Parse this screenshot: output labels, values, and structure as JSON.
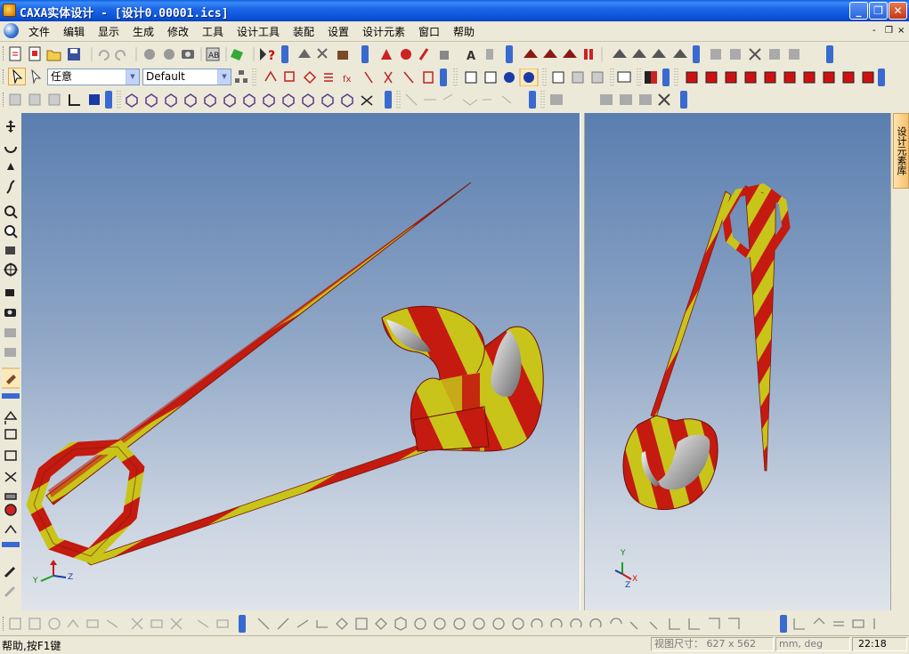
{
  "window": {
    "title": "CAXA实体设计 - [设计0.00001.ics]",
    "buttons": {
      "minimize": "_",
      "restore": "❐",
      "close": "✕"
    }
  },
  "menubar": {
    "items": [
      "文件",
      "编辑",
      "显示",
      "生成",
      "修改",
      "工具",
      "设计工具",
      "装配",
      "设置",
      "设计元素",
      "窗口",
      "帮助"
    ],
    "mdi_buttons": [
      "-",
      "❐",
      "×"
    ]
  },
  "toolbar2": {
    "selection_filter": "任意",
    "style_combo": "Default"
  },
  "side_panel": {
    "tab_label": "设计元素库"
  },
  "viewports": {
    "left": {
      "axis": {
        "x": "X",
        "y": "Y",
        "z": "Z"
      }
    },
    "right": {
      "axis": {
        "x": "X",
        "y": "Y",
        "z": "Z"
      }
    }
  },
  "statusbar": {
    "help": "帮助,按F1键",
    "viewsize": "视图尺寸： 627 x 562",
    "units": "mm, deg",
    "time": "22:18"
  },
  "colors": {
    "pin_red": "#c41a10",
    "pin_yellow": "#c8c41a",
    "titlebar_blue": "#0a52d8",
    "viewport_top": "#5a7eb0",
    "viewport_bottom": "#dfe4ea"
  }
}
